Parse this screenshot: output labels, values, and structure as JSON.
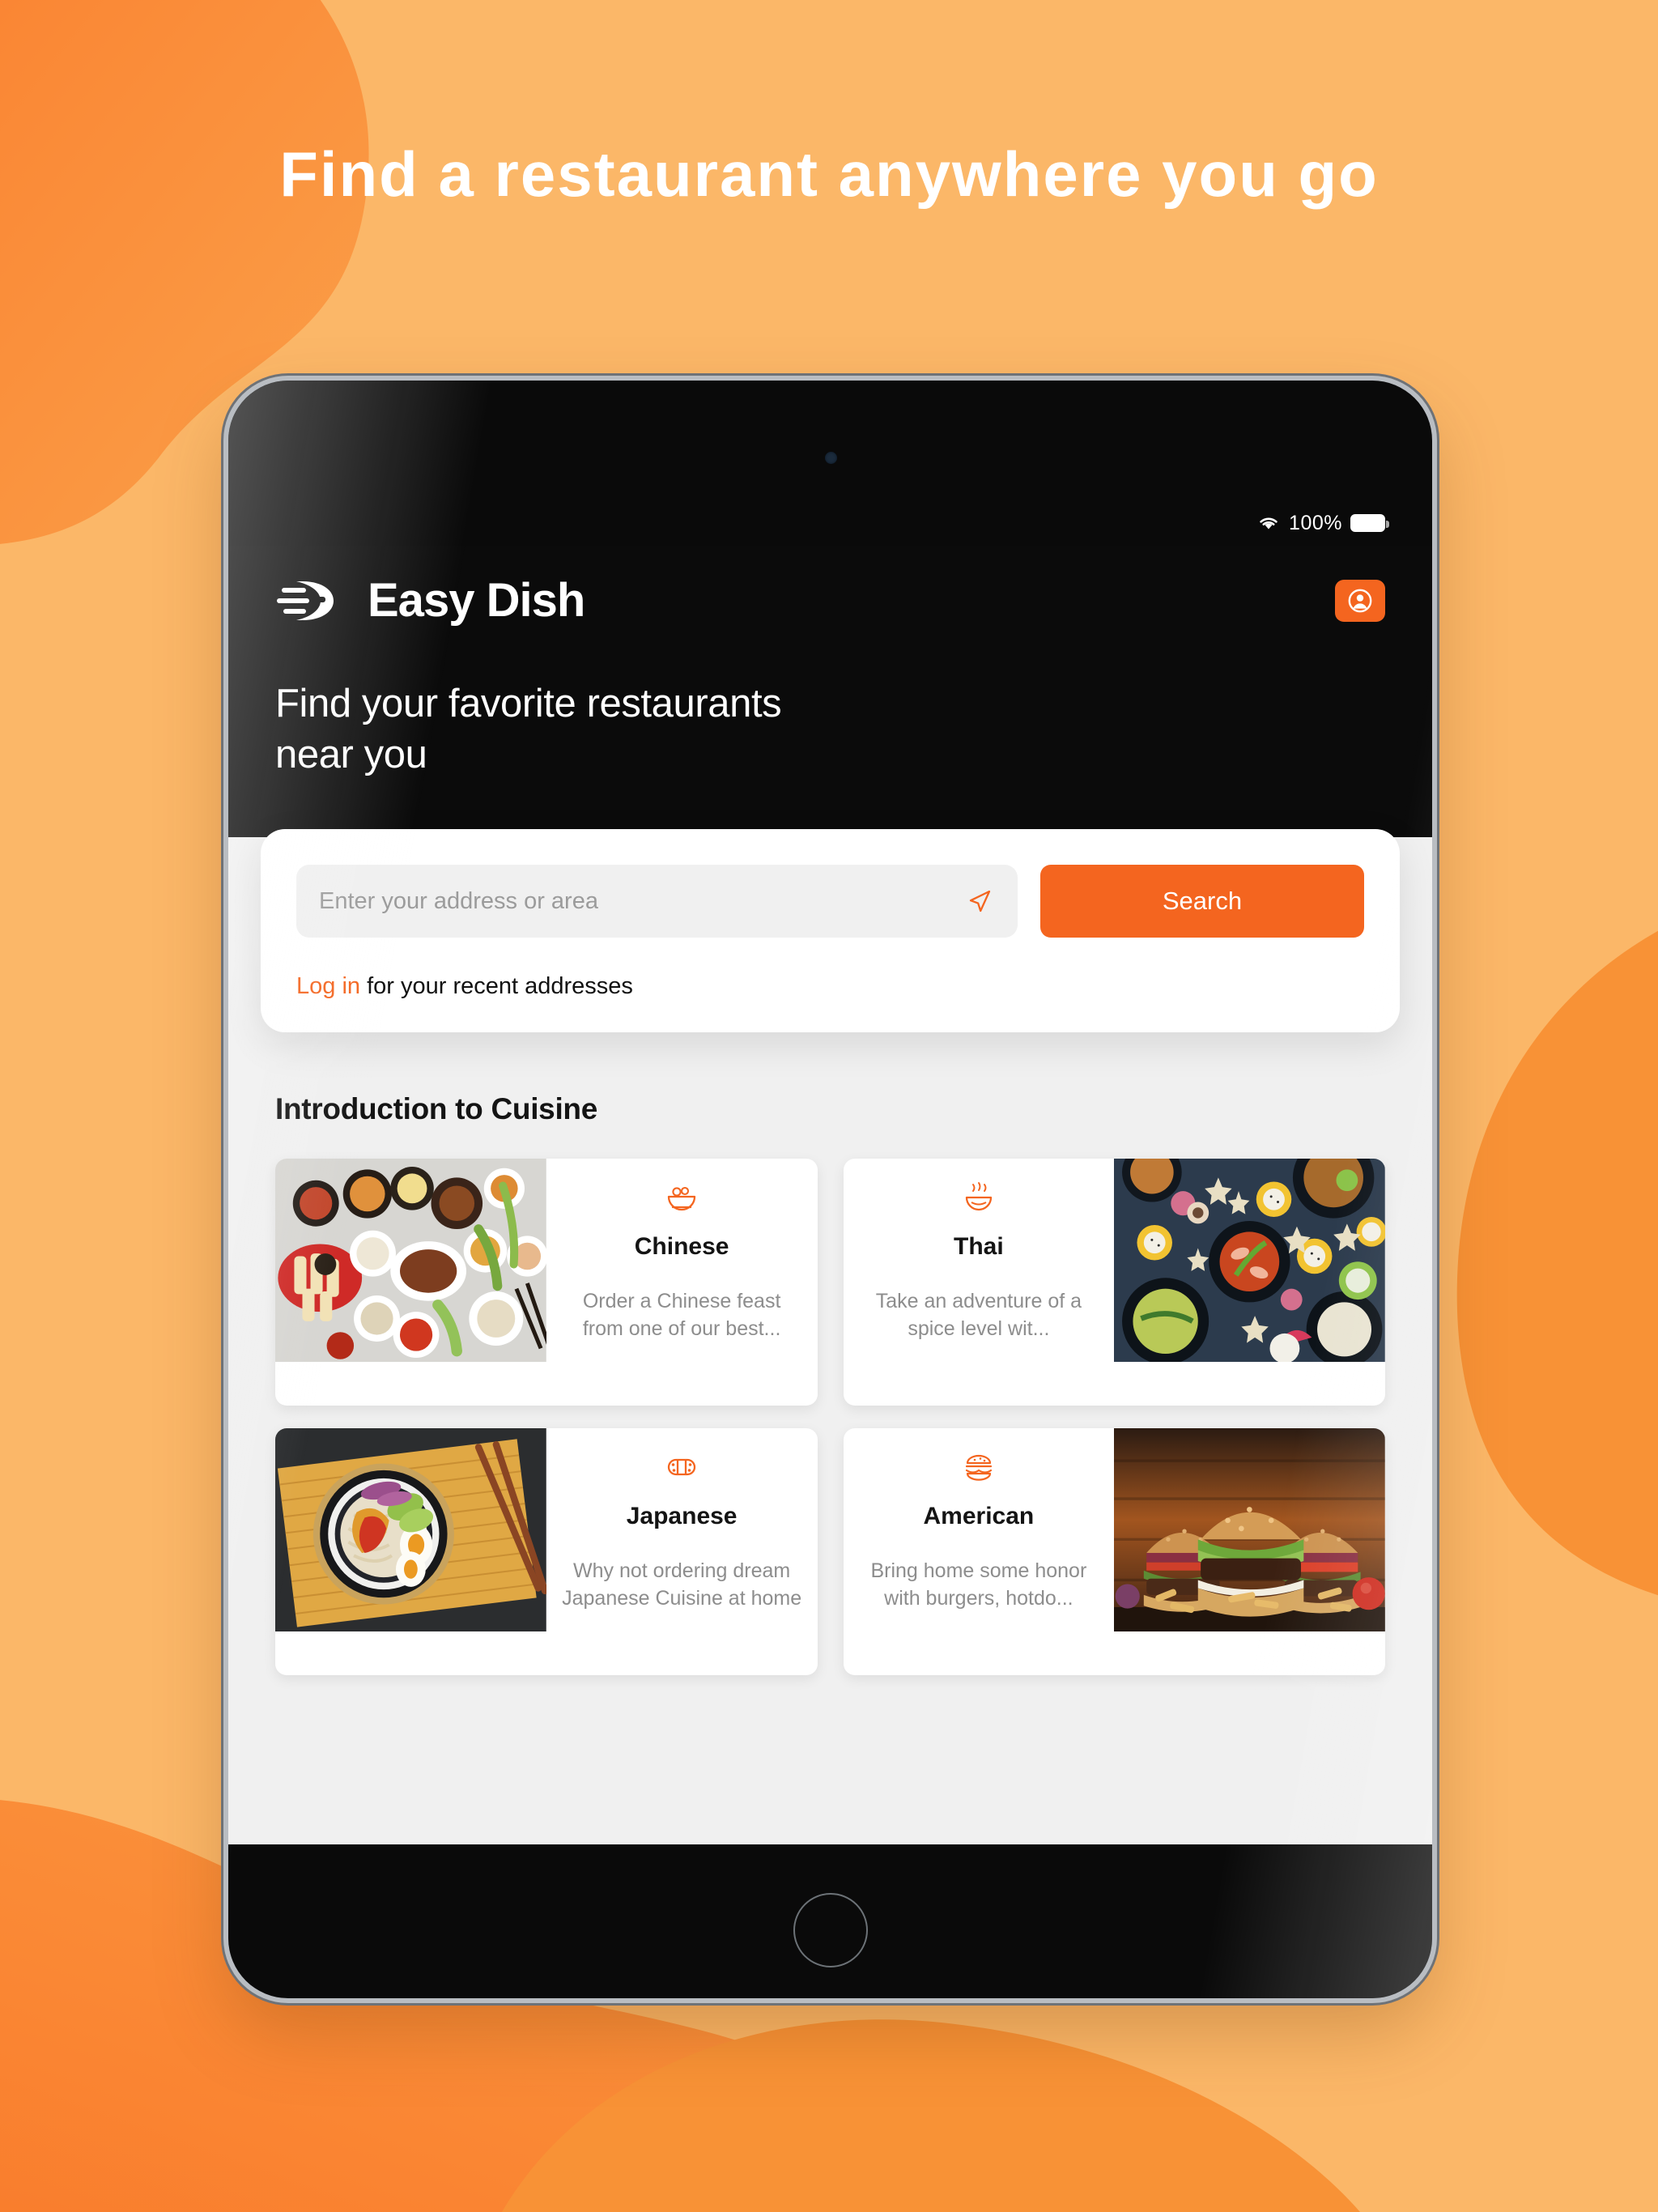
{
  "promo": {
    "headline": "Find a restaurant anywhere you go",
    "bg_color": "#FBB768",
    "blob_color": "#F89236",
    "blob_color_deep": "#F97A2A"
  },
  "device": {
    "type": "tablet",
    "status_bar": {
      "wifi_icon": "wifi-icon",
      "battery_percent": "100%",
      "battery_icon": "battery-full-icon"
    },
    "home_button": "home-button",
    "camera": "front-camera"
  },
  "app": {
    "accent_color": "#F4651F",
    "brand": {
      "name": "Easy Dish",
      "mark_icon": "easy-dish-speed-logo-icon"
    },
    "account_button": {
      "icon": "account-circle-icon",
      "label": "Account"
    },
    "hero_title": "Find your favorite restaurants\nnear you",
    "search": {
      "placeholder": "Enter your address or area",
      "value": "",
      "locate_icon": "navigation-arrow-icon",
      "submit_label": "Search",
      "recent_prefix": "Log in",
      "recent_suffix": " for your recent addresses"
    },
    "cuisine": {
      "heading": "Introduction to Cuisine",
      "cards": [
        {
          "name": "Chinese",
          "description": "Order a Chinese feast from one of our best...",
          "icon": "rice-bowl-icon",
          "media_side": "left",
          "photo": "chinese-feast-photo"
        },
        {
          "name": "Thai",
          "description": "Take an adventure of a spice level wit...",
          "icon": "steaming-bowl-icon",
          "media_side": "right",
          "photo": "thai-spread-photo"
        },
        {
          "name": "Japanese",
          "description": "Why not ordering dream Japanese Cuisine at home",
          "icon": "sushi-roll-icon",
          "media_side": "left",
          "photo": "ramen-bowl-photo"
        },
        {
          "name": "American",
          "description": "Bring home some honor with burgers, hotdo...",
          "icon": "burger-icon",
          "media_side": "right",
          "photo": "burgers-photo"
        }
      ]
    }
  }
}
